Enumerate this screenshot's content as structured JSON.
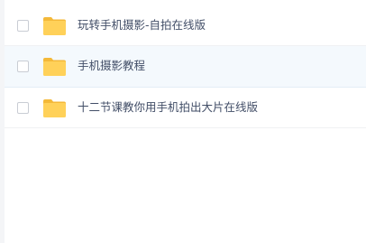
{
  "file_list": {
    "items": [
      {
        "name": "玩转手机摄影-自拍在线版",
        "icon": "folder-icon",
        "selected": false
      },
      {
        "name": "手机摄影教程",
        "icon": "folder-icon",
        "selected": true
      },
      {
        "name": "十二节课教你用手机拍出大片在线版",
        "icon": "folder-icon",
        "selected": false
      }
    ]
  },
  "colors": {
    "folder": "#ffd159",
    "folder_tab": "#f4b939",
    "row_selected_bg": "#f4f9fd",
    "text": "#424e67"
  }
}
